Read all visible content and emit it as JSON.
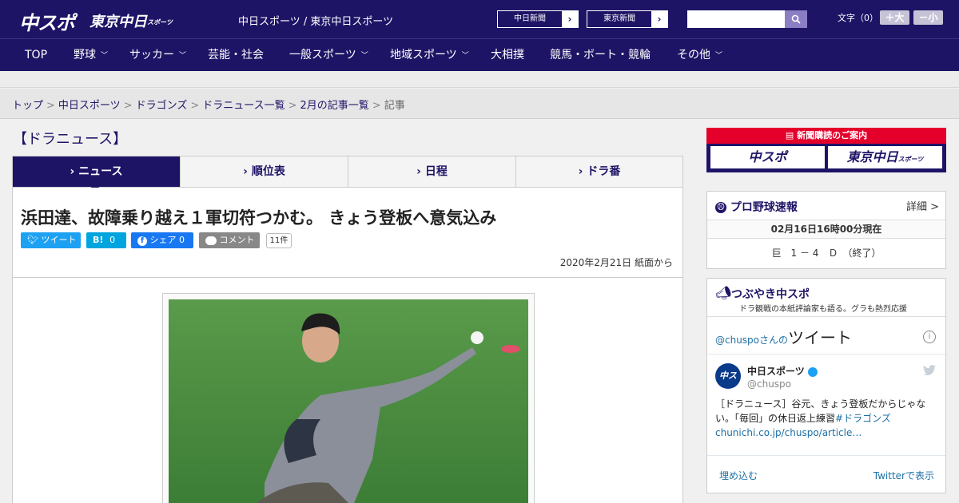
{
  "header": {
    "logo_primary": "中スポ",
    "logo_secondary": "東京中日",
    "logo_secondary_small": "スポーツ",
    "site_name": "中日スポーツ / 東京中日スポーツ",
    "partner_buttons": [
      {
        "label": "中日新聞",
        "icon": "chevron-right-icon"
      },
      {
        "label": "東京新聞",
        "icon": "chevron-right-icon"
      }
    ],
    "search": {
      "placeholder": "",
      "icon": "search-icon"
    },
    "font_size_label": "文字（0）",
    "font_size_plus": "＋大",
    "font_size_minus": "－小"
  },
  "nav": {
    "items": [
      {
        "label": "TOP",
        "dropdown": false
      },
      {
        "label": "野球",
        "dropdown": true
      },
      {
        "label": "サッカー",
        "dropdown": true
      },
      {
        "label": "芸能・社会",
        "dropdown": false
      },
      {
        "label": "一般スポーツ",
        "dropdown": true
      },
      {
        "label": "地域スポーツ",
        "dropdown": true
      },
      {
        "label": "大相撲",
        "dropdown": false
      },
      {
        "label": "競馬・ボート・競輪",
        "dropdown": false
      },
      {
        "label": "その他",
        "dropdown": true
      }
    ],
    "dropdown_icon": "chevron-down-icon"
  },
  "breadcrumb": {
    "links": [
      "トップ",
      "中日スポーツ",
      "ドラゴンズ",
      "ドラニュース一覧",
      "2月の記事一覧"
    ],
    "current": "記事",
    "separator": ">"
  },
  "section_title": "【ドラニュース】",
  "tabs": [
    {
      "label": "ニュース",
      "active": true
    },
    {
      "label": "順位表",
      "active": false
    },
    {
      "label": "日程",
      "active": false
    },
    {
      "label": "ドラ番",
      "active": false
    }
  ],
  "article": {
    "headline": "浜田達、故障乗り越え１軍切符つかむ。 きょう登板へ意気込み",
    "share": {
      "tweet": "ツイート",
      "hatena": "B!",
      "hatena_count": "0",
      "facebook": "シェア",
      "facebook_count": "0",
      "comment": "コメント",
      "comment_count": "11件"
    },
    "date": "2020年2月21日 紙面から"
  },
  "sidebar": {
    "subscribe": {
      "header": "新聞購読のご案内",
      "left": "中スポ",
      "right": "東京中日",
      "right_small": "スポーツ"
    },
    "scores": {
      "title": "プロ野球速報",
      "more": "詳細 >",
      "updated": "02月16日16時00分現在",
      "result": "巨　1 － 4　Ｄ　（終了）"
    },
    "tweets": {
      "title": "つぶやき中スポ",
      "subtitle": "ドラ観戦の本紙評論家も語る。グラも熱烈応援",
      "embed_prefix": "@chuspo",
      "embed_mid": "さんの",
      "embed_title": "ツイート",
      "user_name": "中日スポーツ",
      "user_handle": "@chuspo",
      "avatar_text": "中スポ",
      "text": "［ドラニュース］谷元、きょう登板だからじゃない。「毎回」の休日返上練習",
      "hashtag": "#ドラゴンズ",
      "link": "chunichi.co.jp/chuspo/article…",
      "embed_label": "埋め込む",
      "view_label": "Twitterで表示"
    }
  },
  "colors": {
    "brand_navy": "#1e1466",
    "accent_red": "#e4002b",
    "twitter_blue": "#1da1f2",
    "facebook_blue": "#1877f2"
  }
}
